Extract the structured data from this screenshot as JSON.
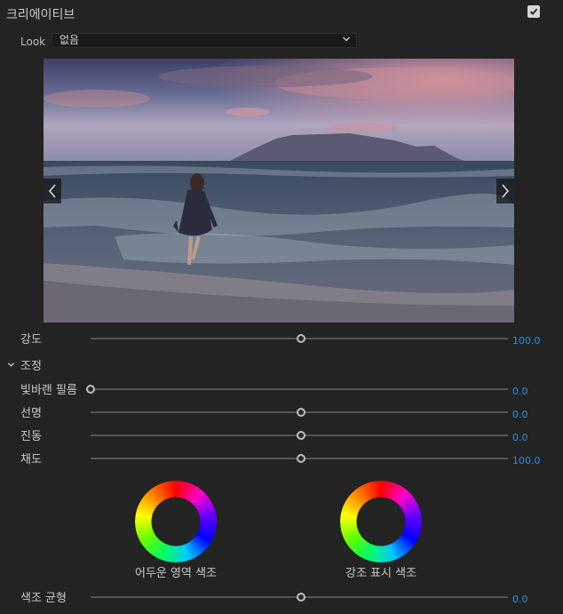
{
  "header": {
    "title": "크리에이티브",
    "checked": true
  },
  "look": {
    "label": "Look",
    "value": "없음"
  },
  "intensity": {
    "label": "강도",
    "value": "100.0",
    "level": 0.5
  },
  "adjustments": {
    "section_label": "조정",
    "params": [
      {
        "label": "빛바랜 필름",
        "value": "0.0",
        "level": 0.0
      },
      {
        "label": "선명",
        "value": "0.0",
        "level": 0.5
      },
      {
        "label": "진동",
        "value": "0.0",
        "level": 0.5
      },
      {
        "label": "채도",
        "value": "100.0",
        "level": 0.5
      }
    ]
  },
  "wheels": {
    "shadow_tint": "어두운 영역 색조",
    "highlight_tint": "강조 표시 색조"
  },
  "tint_balance": {
    "label": "색조 균형",
    "value": "0.0",
    "level": 0.5
  },
  "colors": {
    "accent": "#2e8fe6",
    "background": "#232323"
  }
}
